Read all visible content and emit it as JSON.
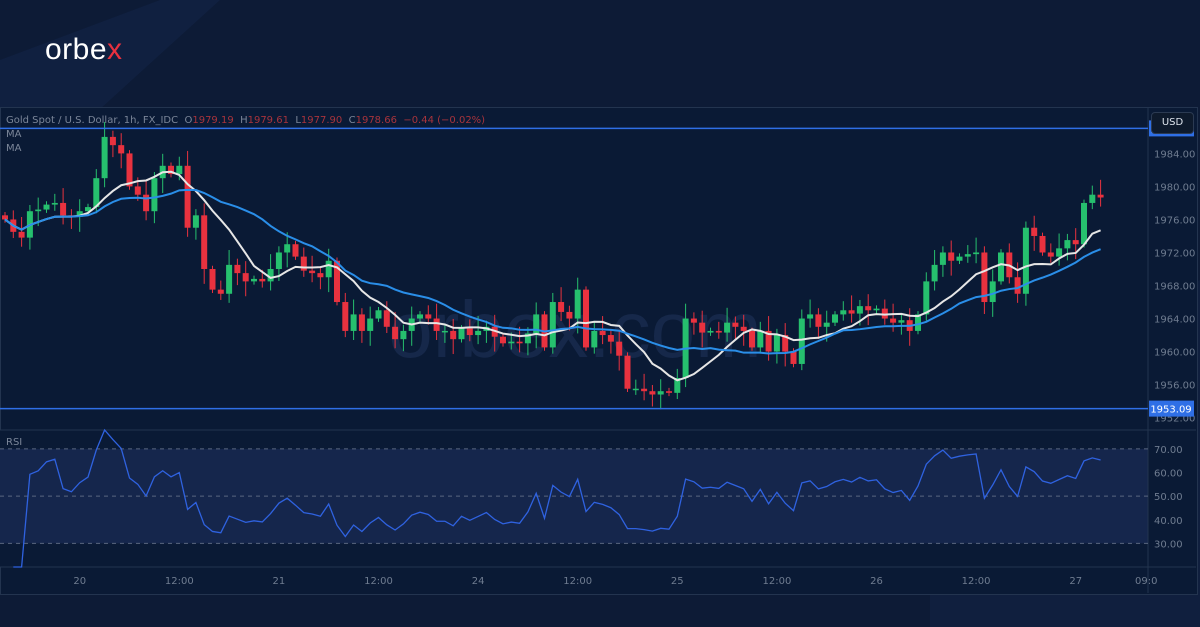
{
  "brand": {
    "logo_main": "orbe",
    "logo_x": "x",
    "watermark": "orbex.com"
  },
  "legend": {
    "symbol": "Gold Spot / U.S. Dollar, 1h, FX_IDC",
    "o_label": "O",
    "o": "1979.19",
    "h_label": "H",
    "h": "1979.61",
    "l_label": "L",
    "l": "1977.90",
    "c_label": "C",
    "c": "1978.66",
    "change": "−0.44 (−0.02%)",
    "ma1": "MA",
    "ma2": "MA"
  },
  "currency": "USD",
  "rsi_label": "RSI",
  "colors": {
    "up": "#26c06e",
    "down": "#e8323f",
    "ma_fast": "#e6e6e6",
    "ma_slow": "#2a8ee8",
    "level": "#2f6fe6",
    "rsi": "#2f62e0"
  },
  "chart_data": {
    "type": "candlestick",
    "timeframe": "1h",
    "closes": [
      1976,
      1974.5,
      1973.8,
      1977,
      1977.2,
      1977.8,
      1978,
      1976.5,
      1976.3,
      1977,
      1977.5,
      1981,
      1986,
      1985,
      1984,
      1980,
      1979,
      1977,
      1981,
      1982.5,
      1981.5,
      1982.5,
      1975,
      1976.5,
      1970,
      1967.5,
      1967,
      1970.5,
      1969.5,
      1968.5,
      1968.8,
      1968.5,
      1970,
      1972,
      1973,
      1971.5,
      1969.8,
      1969.5,
      1969,
      1971,
      1966,
      1962.5,
      1964.5,
      1962.5,
      1964,
      1965,
      1963,
      1961.5,
      1962.5,
      1964,
      1964.5,
      1964,
      1962.5,
      1962.5,
      1961.5,
      1962.8,
      1962,
      1962.5,
      1963,
      1961.8,
      1961,
      1961.2,
      1961,
      1962.2,
      1964.5,
      1960.5,
      1966,
      1964.8,
      1964,
      1967.5,
      1960.5,
      1962.5,
      1962,
      1961.2,
      1959.5,
      1955.5,
      1955.5,
      1955.2,
      1954.8,
      1955.2,
      1955,
      1956.8,
      1964,
      1963.5,
      1962.3,
      1962.5,
      1962.3,
      1963.5,
      1963,
      1962.5,
      1960.5,
      1962.5,
      1960,
      1962,
      1960,
      1958.5,
      1964,
      1964.5,
      1963,
      1963.5,
      1964.5,
      1965,
      1964.6,
      1965.5,
      1965,
      1965.2,
      1964,
      1963.5,
      1963.8,
      1962.5,
      1964.5,
      1968.5,
      1970.5,
      1972,
      1971,
      1971.5,
      1971.8,
      1972,
      1966,
      1968.5,
      1972,
      1969,
      1967,
      1975,
      1974,
      1972,
      1971.5,
      1972.5,
      1973.5,
      1973,
      1978,
      1979,
      1978.66
    ],
    "price_ticks": [
      "1984.00",
      "1980.00",
      "1976.00",
      "1972.00",
      "1968.00",
      "1964.00",
      "1960.00",
      "1956.00",
      "1952.00"
    ],
    "price_tick_values": [
      1984,
      1980,
      1976,
      1972,
      1968,
      1964,
      1960,
      1956,
      1952
    ],
    "levels": [
      {
        "label": "1987.03",
        "value": 1987.03
      },
      {
        "label": "1953.09",
        "value": 1953.09
      }
    ],
    "ylim": [
      1950.5,
      1989.5
    ],
    "moving_averages": [
      {
        "name": "MA",
        "period": 9
      },
      {
        "name": "MA",
        "period": 20
      }
    ],
    "rsi": {
      "period": 14,
      "ticks": [
        "70.00",
        "60.00",
        "50.00",
        "40.00",
        "30.00"
      ],
      "tick_values": [
        70,
        60,
        50,
        40,
        30
      ],
      "bands": [
        70,
        50,
        30
      ],
      "ylim": [
        20,
        78
      ]
    },
    "time_ticks": [
      {
        "label": "20",
        "index": 9
      },
      {
        "label": "12:00",
        "index": 21
      },
      {
        "label": "21",
        "index": 33
      },
      {
        "label": "12:00",
        "index": 45
      },
      {
        "label": "24",
        "index": 57
      },
      {
        "label": "12:00",
        "index": 69
      },
      {
        "label": "25",
        "index": 81
      },
      {
        "label": "12:00",
        "index": 93
      },
      {
        "label": "26",
        "index": 105
      },
      {
        "label": "12:00",
        "index": 117
      },
      {
        "label": "27",
        "index": 129
      },
      {
        "label": "09:0",
        "index": 137.5
      }
    ]
  }
}
